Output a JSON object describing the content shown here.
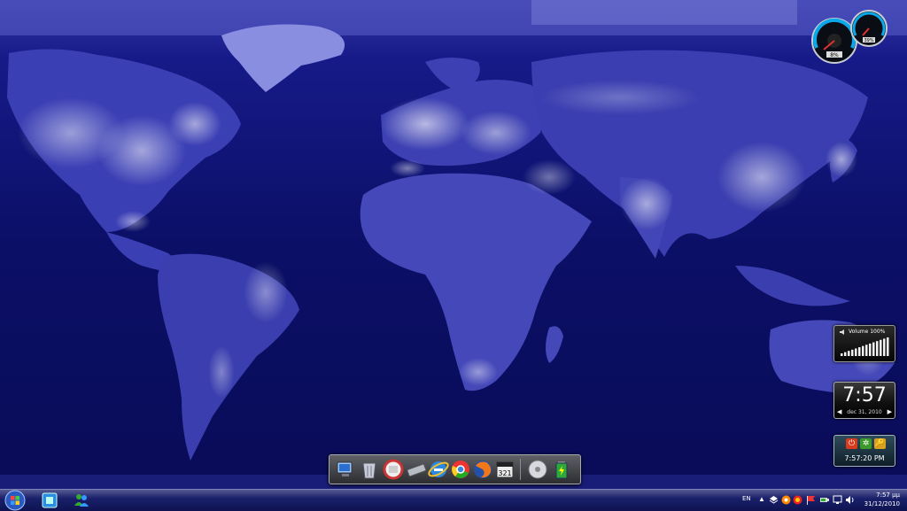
{
  "desktop": {
    "wallpaper_icon": "world-map-at-night-wallpaper"
  },
  "gadgets": {
    "cpu_meter": {
      "cpu_value": "8%",
      "ram_value": "39%"
    },
    "volume": {
      "label": "Volume 100%",
      "level_fraction": 1.0
    },
    "clock": {
      "time": "7:57",
      "date": "dec 31, 2010",
      "prev_arrow": "◀",
      "next_arrow": "▶"
    },
    "shutdown": {
      "time": "7:57:20 PM",
      "buttons": [
        {
          "icon": "power-icon",
          "glyph": "⏻",
          "color": "#d83a1c"
        },
        {
          "icon": "restart-icon",
          "glyph": "✲",
          "color": "#3a9a2a"
        },
        {
          "icon": "lock-icon",
          "glyph": "🔑",
          "color": "#d8a020"
        }
      ]
    }
  },
  "dock": {
    "items": [
      {
        "name": "computer-icon"
      },
      {
        "name": "recycle-bin-icon"
      },
      {
        "name": "calendar-icon"
      },
      {
        "name": "usb-drive-icon"
      },
      {
        "name": "internet-explorer-icon"
      },
      {
        "name": "chrome-icon"
      },
      {
        "name": "firefox-icon"
      },
      {
        "name": "media-player-classic-icon"
      },
      {
        "name": "cd-drive-icon"
      },
      {
        "name": "battery-icon"
      }
    ]
  },
  "taskbar": {
    "start_icon": "windows-orb-icon",
    "pinned": [
      {
        "name": "windows-explorer-icon"
      },
      {
        "name": "messenger-icon"
      }
    ],
    "language": "EN",
    "tray_icons": [
      {
        "name": "show-hidden-icons"
      },
      {
        "name": "dropbox-icon"
      },
      {
        "name": "avast-icon"
      },
      {
        "name": "antivirus-icon"
      },
      {
        "name": "flag-icon"
      },
      {
        "name": "power-icon"
      },
      {
        "name": "network-icon"
      },
      {
        "name": "volume-icon"
      }
    ],
    "clock": {
      "time": "7:57 μμ",
      "date": "31/12/2010"
    }
  }
}
